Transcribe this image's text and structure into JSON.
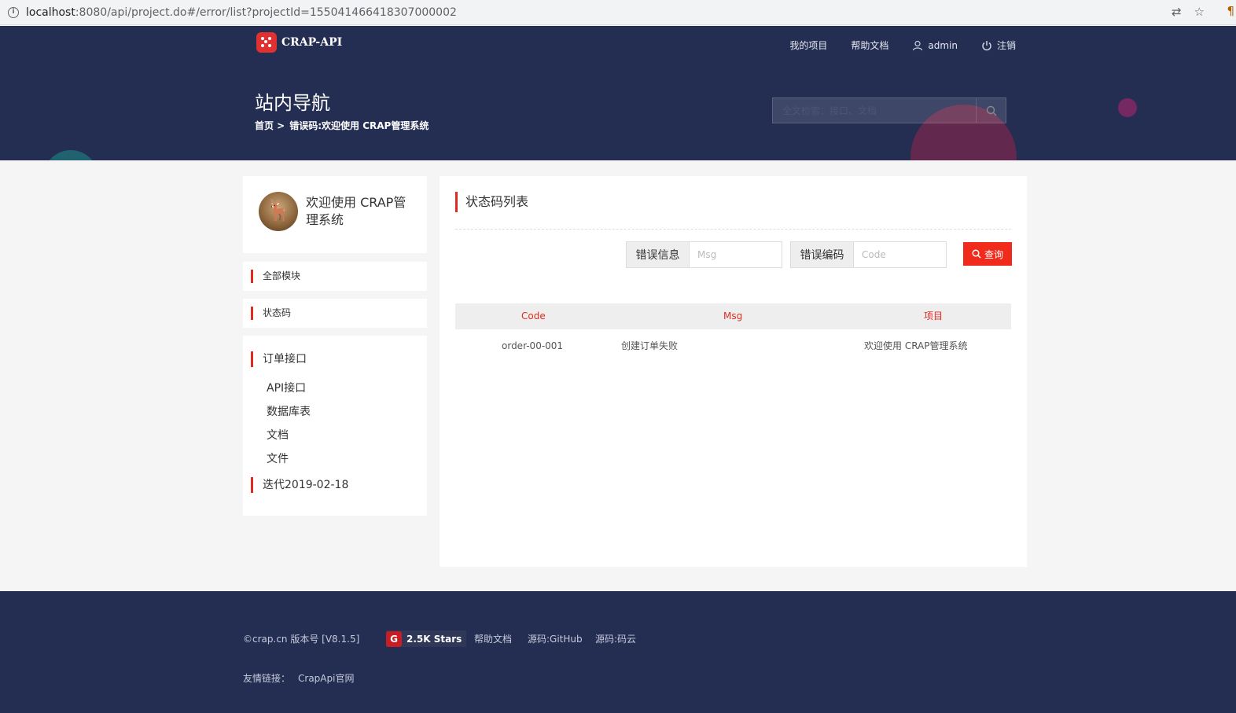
{
  "browser": {
    "url_host": "localhost",
    "url_rest": ":8080/api/project.do#/error/list?projectId=155041466418307000002"
  },
  "header": {
    "logo_text": "CRAP-API",
    "nav": {
      "my_projects": "我的项目",
      "help_docs": "帮助文档",
      "user": "admin",
      "logout": "注销"
    },
    "page_heading": "站内导航",
    "breadcrumb": {
      "home": "首页 >",
      "current": "错误码:欢迎使用 CRAP管理系统"
    },
    "search_placeholder": "全文检索：接口、文档"
  },
  "sidebar": {
    "project_name": "欢迎使用 CRAP管理系统",
    "menu_all_modules": "全部模块",
    "menu_status_codes": "状态码",
    "groups": [
      {
        "title": "订单接口",
        "items": [
          "API接口",
          "数据库表",
          "文档",
          "文件"
        ]
      },
      {
        "title": "迭代2019-02-18",
        "items": []
      }
    ]
  },
  "main": {
    "title": "状态码列表",
    "filter_msg_label": "错误信息",
    "filter_msg_placeholder": "Msg",
    "filter_code_label": "错误编码",
    "filter_code_placeholder": "Code",
    "search_button": "查询",
    "table": {
      "headers": [
        "Code",
        "Msg",
        "项目"
      ],
      "rows": [
        [
          "order-00-001",
          "创建订单失败",
          "欢迎使用 CRAP管理系统"
        ]
      ]
    }
  },
  "footer": {
    "copyright": "©crap.cn 版本号 [V8.1.5]",
    "stars": "2.5K Stars",
    "links": [
      "帮助文档",
      "源码:GitHub",
      "源码:码云"
    ],
    "friends_label": "友情链接：",
    "friends": [
      "CrapApi官网"
    ]
  },
  "colors": {
    "header_bg": "#242e52",
    "accent": "#e02b20",
    "button": "#f02b1c"
  }
}
